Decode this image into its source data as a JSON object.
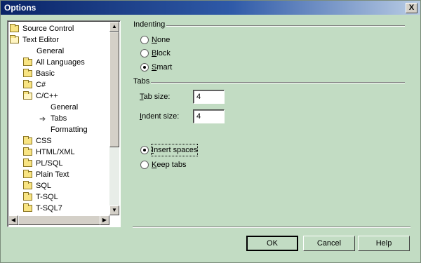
{
  "window": {
    "title": "Options",
    "close_glyph": "X"
  },
  "tree": {
    "items": [
      {
        "label": "Source Control",
        "icon": "folder"
      },
      {
        "label": "Text Editor",
        "icon": "folder-open"
      },
      {
        "label": "General",
        "icon": "none"
      },
      {
        "label": "All Languages",
        "icon": "folder"
      },
      {
        "label": "Basic",
        "icon": "folder"
      },
      {
        "label": "C#",
        "icon": "folder"
      },
      {
        "label": "C/C++",
        "icon": "folder-open"
      },
      {
        "label": "General",
        "icon": "none"
      },
      {
        "label": "Tabs",
        "icon": "arrow"
      },
      {
        "label": "Formatting",
        "icon": "none"
      },
      {
        "label": "CSS",
        "icon": "folder"
      },
      {
        "label": "HTML/XML",
        "icon": "folder"
      },
      {
        "label": "PL/SQL",
        "icon": "folder"
      },
      {
        "label": "Plain Text",
        "icon": "folder"
      },
      {
        "label": "SQL",
        "icon": "folder"
      },
      {
        "label": "T-SQL",
        "icon": "folder"
      },
      {
        "label": "T-SQL7",
        "icon": "folder"
      }
    ],
    "scroll_up_glyph": "▲",
    "scroll_down_glyph": "▼",
    "scroll_left_glyph": "◀",
    "scroll_right_glyph": "▶"
  },
  "indenting": {
    "title": "Indenting",
    "options": [
      {
        "label": "None",
        "checked": false
      },
      {
        "label": "Block",
        "checked": false
      },
      {
        "label": "Smart",
        "checked": true
      }
    ]
  },
  "tabs": {
    "title": "Tabs",
    "tab_size_label": "Tab size:",
    "tab_size_value": "4",
    "indent_size_label": "Indent size:",
    "indent_size_value": "4",
    "insert_spaces_label": "Insert spaces",
    "insert_spaces_checked": true,
    "keep_tabs_label": "Keep tabs",
    "keep_tabs_checked": false
  },
  "buttons": {
    "ok": "OK",
    "cancel": "Cancel",
    "help": "Help"
  },
  "colors": {
    "dialog_bg": "#c2dcc3",
    "title_start": "#0a2467",
    "title_end": "#b9cce4"
  }
}
